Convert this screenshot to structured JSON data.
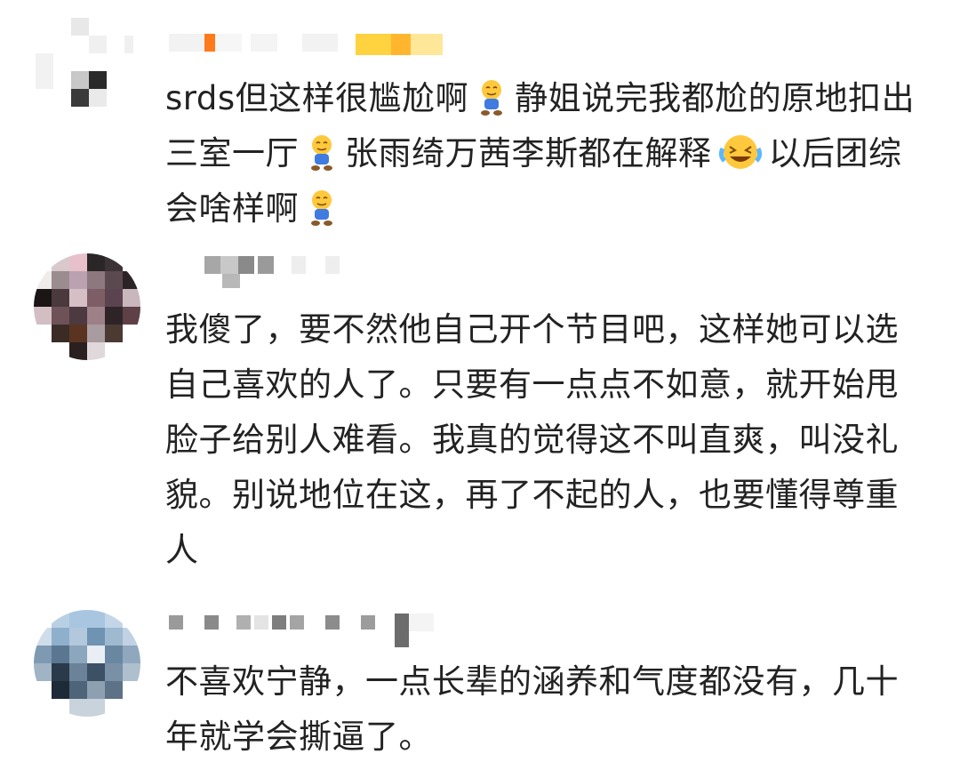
{
  "comments": [
    {
      "segments": [
        "srds但这样很尴尬啊",
        "静姐说完我都尬的原地扣出三室一厅",
        "张雨绮万茜李斯都在解释",
        "以后团综会啥样啊"
      ],
      "emojis": [
        "awkward-emoji",
        "awkward-emoji",
        "laugh-cry-emoji",
        "awkward-emoji"
      ]
    },
    {
      "text": "我傻了，要不然他自己开个节目吧，这样她可以选自己喜欢的人了。只要有一点点不如意，就开始甩脸子给别人难看。我真的觉得这不叫直爽，叫没礼貌。别说地位在这，再了不起的人，也要懂得尊重人"
    },
    {
      "text": "不喜欢宁静，一点长辈的涵养和气度都没有，几十年就学会撕逼了。"
    }
  ],
  "colors": {
    "text": "#222222",
    "name_blur": "#d9d9d9",
    "accent_orange": "#ff7a1a",
    "accent_yellow": "#ffcc33"
  }
}
